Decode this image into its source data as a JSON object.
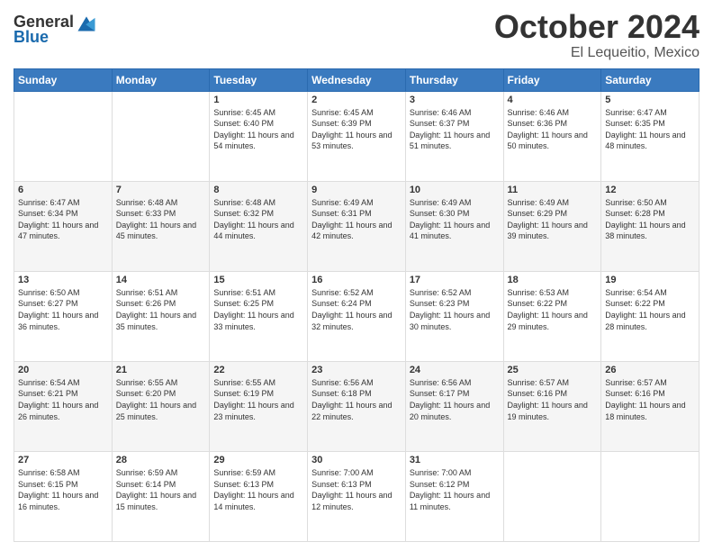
{
  "header": {
    "logo_line1": "General",
    "logo_line2": "Blue",
    "month": "October 2024",
    "location": "El Lequeitio, Mexico"
  },
  "weekdays": [
    "Sunday",
    "Monday",
    "Tuesday",
    "Wednesday",
    "Thursday",
    "Friday",
    "Saturday"
  ],
  "weeks": [
    [
      {
        "day": "",
        "info": ""
      },
      {
        "day": "",
        "info": ""
      },
      {
        "day": "1",
        "info": "Sunrise: 6:45 AM\nSunset: 6:40 PM\nDaylight: 11 hours and 54 minutes."
      },
      {
        "day": "2",
        "info": "Sunrise: 6:45 AM\nSunset: 6:39 PM\nDaylight: 11 hours and 53 minutes."
      },
      {
        "day": "3",
        "info": "Sunrise: 6:46 AM\nSunset: 6:37 PM\nDaylight: 11 hours and 51 minutes."
      },
      {
        "day": "4",
        "info": "Sunrise: 6:46 AM\nSunset: 6:36 PM\nDaylight: 11 hours and 50 minutes."
      },
      {
        "day": "5",
        "info": "Sunrise: 6:47 AM\nSunset: 6:35 PM\nDaylight: 11 hours and 48 minutes."
      }
    ],
    [
      {
        "day": "6",
        "info": "Sunrise: 6:47 AM\nSunset: 6:34 PM\nDaylight: 11 hours and 47 minutes."
      },
      {
        "day": "7",
        "info": "Sunrise: 6:48 AM\nSunset: 6:33 PM\nDaylight: 11 hours and 45 minutes."
      },
      {
        "day": "8",
        "info": "Sunrise: 6:48 AM\nSunset: 6:32 PM\nDaylight: 11 hours and 44 minutes."
      },
      {
        "day": "9",
        "info": "Sunrise: 6:49 AM\nSunset: 6:31 PM\nDaylight: 11 hours and 42 minutes."
      },
      {
        "day": "10",
        "info": "Sunrise: 6:49 AM\nSunset: 6:30 PM\nDaylight: 11 hours and 41 minutes."
      },
      {
        "day": "11",
        "info": "Sunrise: 6:49 AM\nSunset: 6:29 PM\nDaylight: 11 hours and 39 minutes."
      },
      {
        "day": "12",
        "info": "Sunrise: 6:50 AM\nSunset: 6:28 PM\nDaylight: 11 hours and 38 minutes."
      }
    ],
    [
      {
        "day": "13",
        "info": "Sunrise: 6:50 AM\nSunset: 6:27 PM\nDaylight: 11 hours and 36 minutes."
      },
      {
        "day": "14",
        "info": "Sunrise: 6:51 AM\nSunset: 6:26 PM\nDaylight: 11 hours and 35 minutes."
      },
      {
        "day": "15",
        "info": "Sunrise: 6:51 AM\nSunset: 6:25 PM\nDaylight: 11 hours and 33 minutes."
      },
      {
        "day": "16",
        "info": "Sunrise: 6:52 AM\nSunset: 6:24 PM\nDaylight: 11 hours and 32 minutes."
      },
      {
        "day": "17",
        "info": "Sunrise: 6:52 AM\nSunset: 6:23 PM\nDaylight: 11 hours and 30 minutes."
      },
      {
        "day": "18",
        "info": "Sunrise: 6:53 AM\nSunset: 6:22 PM\nDaylight: 11 hours and 29 minutes."
      },
      {
        "day": "19",
        "info": "Sunrise: 6:54 AM\nSunset: 6:22 PM\nDaylight: 11 hours and 28 minutes."
      }
    ],
    [
      {
        "day": "20",
        "info": "Sunrise: 6:54 AM\nSunset: 6:21 PM\nDaylight: 11 hours and 26 minutes."
      },
      {
        "day": "21",
        "info": "Sunrise: 6:55 AM\nSunset: 6:20 PM\nDaylight: 11 hours and 25 minutes."
      },
      {
        "day": "22",
        "info": "Sunrise: 6:55 AM\nSunset: 6:19 PM\nDaylight: 11 hours and 23 minutes."
      },
      {
        "day": "23",
        "info": "Sunrise: 6:56 AM\nSunset: 6:18 PM\nDaylight: 11 hours and 22 minutes."
      },
      {
        "day": "24",
        "info": "Sunrise: 6:56 AM\nSunset: 6:17 PM\nDaylight: 11 hours and 20 minutes."
      },
      {
        "day": "25",
        "info": "Sunrise: 6:57 AM\nSunset: 6:16 PM\nDaylight: 11 hours and 19 minutes."
      },
      {
        "day": "26",
        "info": "Sunrise: 6:57 AM\nSunset: 6:16 PM\nDaylight: 11 hours and 18 minutes."
      }
    ],
    [
      {
        "day": "27",
        "info": "Sunrise: 6:58 AM\nSunset: 6:15 PM\nDaylight: 11 hours and 16 minutes."
      },
      {
        "day": "28",
        "info": "Sunrise: 6:59 AM\nSunset: 6:14 PM\nDaylight: 11 hours and 15 minutes."
      },
      {
        "day": "29",
        "info": "Sunrise: 6:59 AM\nSunset: 6:13 PM\nDaylight: 11 hours and 14 minutes."
      },
      {
        "day": "30",
        "info": "Sunrise: 7:00 AM\nSunset: 6:13 PM\nDaylight: 11 hours and 12 minutes."
      },
      {
        "day": "31",
        "info": "Sunrise: 7:00 AM\nSunset: 6:12 PM\nDaylight: 11 hours and 11 minutes."
      },
      {
        "day": "",
        "info": ""
      },
      {
        "day": "",
        "info": ""
      }
    ]
  ]
}
